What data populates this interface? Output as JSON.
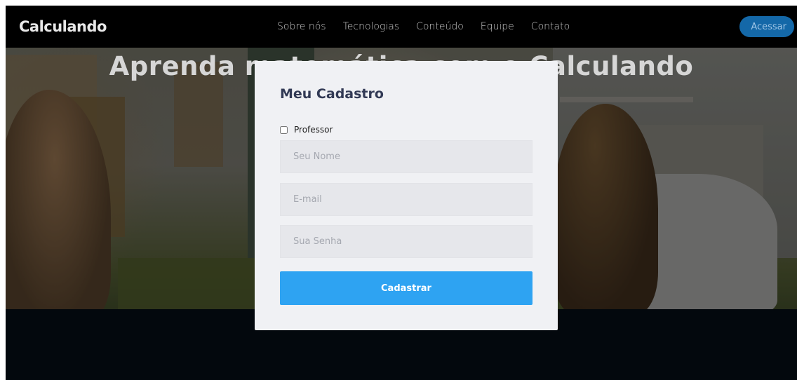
{
  "brand": "Calculando",
  "nav": [
    "Sobre nós",
    "Tecnologias",
    "Conteúdo",
    "Equipe",
    "Contato"
  ],
  "access_button": "Acessar",
  "hero": {
    "title": "Aprenda matemática com o Calculando"
  },
  "modal": {
    "title": "Meu Cadastro",
    "checkbox_label": "Professor",
    "checkbox_checked": false,
    "name_placeholder": "Seu Nome",
    "email_placeholder": "E-mail",
    "password_placeholder": "Sua Senha",
    "submit_label": "Cadastrar"
  },
  "colors": {
    "navbar": "#000000",
    "accent_button": "#1468a8",
    "submit_button": "#2ea3f2",
    "modal_title": "#323a55",
    "modal_background": "#f0f1f4"
  }
}
